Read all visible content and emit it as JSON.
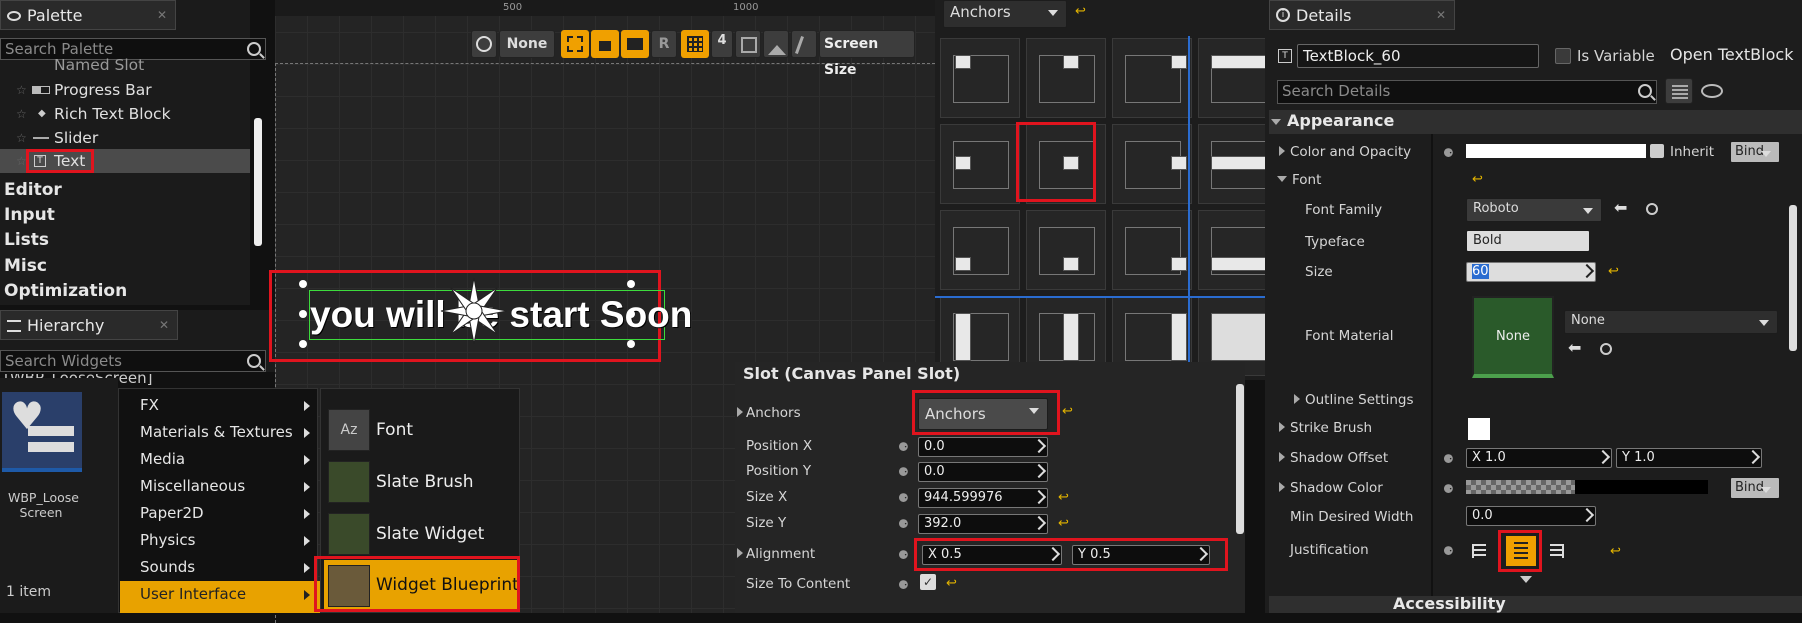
{
  "palette": {
    "tab": "Palette",
    "search_placeholder": "Search Palette",
    "items": [
      "Named Slot",
      "Progress Bar",
      "Rich Text Block",
      "Slider",
      "Text"
    ],
    "categories": [
      "Editor",
      "Input",
      "Lists",
      "Misc",
      "Optimization"
    ]
  },
  "hierarchy": {
    "tab": "Hierarchy",
    "search_placeholder": "Search Widgets",
    "root_label": "[WBP_LooseScreen]"
  },
  "content": {
    "asset_label": "WBP_Loose Screen",
    "count": "1 item"
  },
  "context_menu": {
    "items": [
      "FX",
      "Materials & Textures",
      "Media",
      "Miscellaneous",
      "Paper2D",
      "Physics",
      "Sounds",
      "User Interface"
    ],
    "submenu": [
      "Font",
      "Slate Brush",
      "Slate Widget Style",
      "Widget Blueprint"
    ]
  },
  "designer": {
    "ruler": [
      "500",
      "1000"
    ],
    "toolbar": {
      "none_label": "None",
      "r_label": "R",
      "grid_count": "4",
      "screen_size": "Screen Size"
    },
    "canvas_text": "you will be start Soon"
  },
  "anchors_popup": {
    "combo": "Anchors"
  },
  "slot": {
    "title": "Slot (Canvas Panel Slot)",
    "anchors_label": "Anchors",
    "anchors_value": "Anchors",
    "position_x_label": "Position X",
    "position_x": "0.0",
    "position_y_label": "Position Y",
    "position_y": "0.0",
    "size_x_label": "Size X",
    "size_x": "944.599976",
    "size_y_label": "Size Y",
    "size_y": "392.0",
    "alignment_label": "Alignment",
    "alignment_x": "X  0.5",
    "alignment_y": "Y  0.5",
    "size_to_content_label": "Size To Content"
  },
  "details": {
    "tab": "Details",
    "name": "TextBlock_60",
    "is_variable": "Is Variable",
    "open": "Open TextBlock",
    "search_placeholder": "Search Details",
    "section": "Appearance",
    "color_label": "Color and Opacity",
    "inherit": "Inherit",
    "bind": "Bind",
    "font_label": "Font",
    "font_family_label": "Font Family",
    "font_family": "Roboto",
    "typeface_label": "Typeface",
    "typeface": "Bold",
    "size_label": "Size",
    "size": "60",
    "font_material_label": "Font Material",
    "font_material": "None",
    "font_material_combo": "None",
    "outline_label": "Outline Settings",
    "strike_label": "Strike Brush",
    "shadow_offset_label": "Shadow Offset",
    "shadow_offset_x": "X  1.0",
    "shadow_offset_y": "Y  1.0",
    "shadow_color_label": "Shadow Color",
    "min_width_label": "Min Desired Width",
    "min_width": "0.0",
    "justification_label": "Justification",
    "accessibility": "Accessibility"
  },
  "colors": {
    "highlight": "#e0141e",
    "accent": "#f0a000",
    "selection": "#e8a200"
  }
}
